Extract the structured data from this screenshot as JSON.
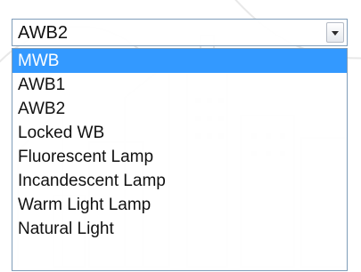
{
  "select": {
    "value": "AWB2",
    "arrow_icon": "chevron-down-icon"
  },
  "options": [
    {
      "label": "MWB",
      "highlighted": true
    },
    {
      "label": "AWB1",
      "highlighted": false
    },
    {
      "label": "AWB2",
      "highlighted": false
    },
    {
      "label": "Locked WB",
      "highlighted": false
    },
    {
      "label": "Fluorescent Lamp",
      "highlighted": false
    },
    {
      "label": "Incandescent Lamp",
      "highlighted": false
    },
    {
      "label": "Warm Light Lamp",
      "highlighted": false
    },
    {
      "label": "Natural Light",
      "highlighted": false
    }
  ],
  "colors": {
    "highlight": "#3399ff",
    "border": "#7f9db9",
    "text": "#111111",
    "highlight_text": "#ffffff"
  }
}
